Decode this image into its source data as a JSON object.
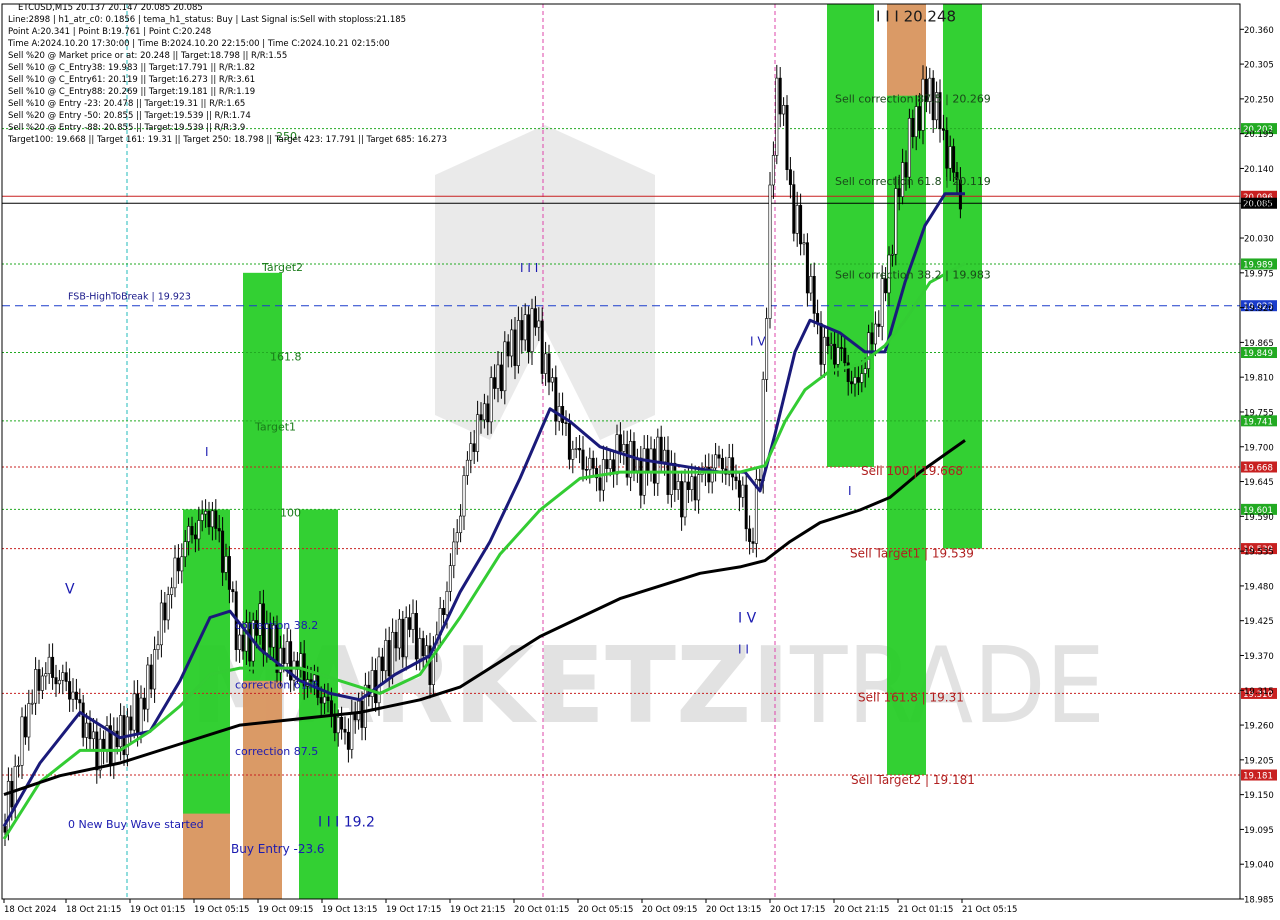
{
  "header": {
    "lines": [
      "ETCUSD,M15  20.137 20.147 20.085 20.085",
      "Line:2898 | h1_atr_c0: 0.1856 | tema_h1_status: Buy | Last Signal is:Sell with stoploss:21.185",
      "Point A:20.341 | Point B:19.761 | Point C:20.248",
      "Time A:2024.10.20 17:30:00 | Time B:2024.10.20 22:15:00 | Time C:2024.10.21 02:15:00",
      "Sell %20 @ Market price or at: 20.248 || Target:18.798 || R/R:1.55",
      "Sell %10 @ C_Entry38: 19.983 || Target:17.791 || R/R:1.82",
      "Sell %10 @ C_Entry61: 20.119 || Target:16.273 || R/R:3.61",
      "Sell %10 @ C_Entry88: 20.269 || Target:19.181 || R/R:1.19",
      "Sell %10 @ Entry -23: 20.478 || Target:19.31 || R/R:1.65",
      "Sell %20 @ Entry -50: 20.855 || Target:19.539 || R/R:1.74",
      "Sell %20 @ Entry -88: 20.855 || Target:19.539 || R/R:3.9",
      "Target100: 19.668 || Target 161: 19.31 || Target 250: 18.798 || Target 423: 17.791 || Target 685: 16.273"
    ]
  },
  "chart_data": {
    "type": "line",
    "symbol": "ETCUSD",
    "timeframe": "M15",
    "ylim": [
      18.985,
      20.4
    ],
    "y_ticks": [
      "20.360",
      "20.305",
      "20.250",
      "20.195",
      "20.140",
      "20.085",
      "20.030",
      "19.975",
      "19.920",
      "19.865",
      "19.810",
      "19.755",
      "19.700",
      "19.645",
      "19.590",
      "19.535",
      "19.480",
      "19.425",
      "19.370",
      "19.315",
      "19.260",
      "19.205",
      "19.150",
      "19.095",
      "19.040",
      "18.985"
    ],
    "x_ticks": [
      "18 Oct 2024",
      "18 Oct 21:15",
      "19 Oct 01:15",
      "19 Oct 05:15",
      "19 Oct 09:15",
      "19 Oct 13:15",
      "19 Oct 17:15",
      "19 Oct 21:15",
      "20 Oct 01:15",
      "20 Oct 05:15",
      "20 Oct 09:15",
      "20 Oct 13:15",
      "20 Oct 17:15",
      "20 Oct 21:15",
      "21 Oct 01:15",
      "21 Oct 05:15"
    ],
    "levels": [
      {
        "label": "20.203",
        "value": 20.203,
        "color": "#22aa22",
        "style": "dotted"
      },
      {
        "label": "20.096",
        "value": 20.096,
        "color": "#c82020",
        "style": "solid"
      },
      {
        "label": "20.085",
        "value": 20.085,
        "color": "#000000",
        "style": "solid"
      },
      {
        "label": "19.989",
        "value": 19.989,
        "color": "#22aa22",
        "style": "dotted"
      },
      {
        "label": "19.923",
        "value": 19.923,
        "color": "#1a3ccc",
        "style": "dashed"
      },
      {
        "label": "19.849",
        "value": 19.849,
        "color": "#22aa22",
        "style": "dotted"
      },
      {
        "label": "19.741",
        "value": 19.741,
        "color": "#22aa22",
        "style": "dotted"
      },
      {
        "label": "19.668",
        "value": 19.668,
        "color": "#c82020",
        "style": "dotted"
      },
      {
        "label": "19.601",
        "value": 19.601,
        "color": "#22aa22",
        "style": "dotted"
      },
      {
        "label": "19.539",
        "value": 19.539,
        "color": "#c82020",
        "style": "dotted"
      },
      {
        "label": "19.310",
        "value": 19.31,
        "color": "#c82020",
        "style": "dotted"
      },
      {
        "label": "19.181",
        "value": 19.181,
        "color": "#c82020",
        "style": "dotted"
      }
    ],
    "zones": [
      {
        "x0": 183,
        "x1": 230,
        "top": 19.601,
        "bottom": 18.985,
        "color": "#22cc22"
      },
      {
        "x0": 183,
        "x1": 230,
        "top": 19.12,
        "bottom": 18.985,
        "color": "#e8956a"
      },
      {
        "x0": 243,
        "x1": 282,
        "top": 19.975,
        "bottom": 18.985,
        "color": "#22cc22"
      },
      {
        "x0": 243,
        "x1": 282,
        "top": 19.33,
        "bottom": 18.985,
        "color": "#e8956a"
      },
      {
        "x0": 299,
        "x1": 338,
        "top": 19.601,
        "bottom": 18.985,
        "color": "#22cc22"
      },
      {
        "x0": 827,
        "x1": 874,
        "top": 20.4,
        "bottom": 19.668,
        "color": "#22cc22"
      },
      {
        "x0": 887,
        "x1": 926,
        "top": 20.4,
        "bottom": 19.181,
        "color": "#22cc22"
      },
      {
        "x0": 887,
        "x1": 926,
        "top": 20.4,
        "bottom": 20.255,
        "color": "#e8956a"
      },
      {
        "x0": 943,
        "x1": 982,
        "top": 20.4,
        "bottom": 19.539,
        "color": "#22cc22"
      }
    ],
    "annotations": [
      {
        "text": "FSB-HighToBreak | 19.923",
        "x": 68,
        "y": 19.933,
        "color": "#1a1a8a",
        "size": 9.5
      },
      {
        "text": "Target2",
        "x": 262,
        "y": 19.978,
        "color": "#1a7a1a",
        "size": 11
      },
      {
        "text": "161.8",
        "x": 270,
        "y": 19.836,
        "color": "#1a7a1a",
        "size": 11
      },
      {
        "text": "Target1",
        "x": 255,
        "y": 19.726,
        "color": "#1a7a1a",
        "size": 11
      },
      {
        "text": "100",
        "x": 280,
        "y": 19.59,
        "color": "#1a7a1a",
        "size": 11
      },
      {
        "text": "correction 38.2",
        "x": 235,
        "y": 19.412,
        "color": "#1a1ab0",
        "size": 11
      },
      {
        "text": "correction 61.8",
        "x": 235,
        "y": 19.318,
        "color": "#1a1ab0",
        "size": 11
      },
      {
        "text": "correction 87.5",
        "x": 235,
        "y": 19.213,
        "color": "#1a1ab0",
        "size": 11
      },
      {
        "text": "0 New Buy Wave started",
        "x": 68,
        "y": 19.097,
        "color": "#1a1ab0",
        "size": 11
      },
      {
        "text": "Buy Entry -23.6",
        "x": 231,
        "y": 19.058,
        "color": "#1a1ab0",
        "size": 12
      },
      {
        "text": "I I I 19.2",
        "x": 318,
        "y": 19.1,
        "color": "#1a1ab0",
        "size": 14
      },
      {
        "text": "V",
        "x": 65,
        "y": 19.468,
        "color": "#1a1ab0",
        "size": 14
      },
      {
        "text": "I",
        "x": 205,
        "y": 19.685,
        "color": "#1a1ab0",
        "size": 12
      },
      {
        "text": "I I I",
        "x": 520,
        "y": 19.976,
        "color": "#1a1ab0",
        "size": 12
      },
      {
        "text": "I V",
        "x": 750,
        "y": 19.86,
        "color": "#1a1ab0",
        "size": 12
      },
      {
        "text": "I V",
        "x": 738,
        "y": 19.422,
        "color": "#1a1ab0",
        "size": 14
      },
      {
        "text": "I I",
        "x": 738,
        "y": 19.373,
        "color": "#1a1ab0",
        "size": 12
      },
      {
        "text": "I",
        "x": 848,
        "y": 19.624,
        "color": "#1a1ab0",
        "size": 12
      },
      {
        "text": "I I I 20.248",
        "x": 876,
        "y": 20.372,
        "color": "#1a1a1a",
        "size": 15
      },
      {
        "text": "Sell correction 87.5 | 20.269",
        "x": 835,
        "y": 20.244,
        "color": "#1a4a1a",
        "size": 11
      },
      {
        "text": "Sell correction 61.8 | 20.119",
        "x": 835,
        "y": 20.114,
        "color": "#1a4a1a",
        "size": 11
      },
      {
        "text": "Sell correction 38.2 | 19.983",
        "x": 835,
        "y": 19.966,
        "color": "#1a4a1a",
        "size": 11
      },
      {
        "text": "Sell 100 | 19.668",
        "x": 861,
        "y": 19.655,
        "color": "#b02020",
        "size": 12
      },
      {
        "text": "Sell Target1 | 19.539",
        "x": 850,
        "y": 19.525,
        "color": "#b02020",
        "size": 12
      },
      {
        "text": "Sell 161.8 | 19.31",
        "x": 858,
        "y": 19.297,
        "color": "#b02020",
        "size": 12
      },
      {
        "text": "Sell Target2 | 19.181",
        "x": 851,
        "y": 19.167,
        "color": "#b02020",
        "size": 12
      },
      {
        "text": "250",
        "x": 276,
        "y": 20.185,
        "color": "#1a7a1a",
        "size": 11
      }
    ],
    "series": [
      {
        "type": "ma",
        "color": "#1a1a7a",
        "points": [
          [
            4,
            19.1
          ],
          [
            40,
            19.2
          ],
          [
            80,
            19.28
          ],
          [
            120,
            19.24
          ],
          [
            150,
            19.25
          ],
          [
            180,
            19.33
          ],
          [
            210,
            19.43
          ],
          [
            230,
            19.44
          ],
          [
            260,
            19.38
          ],
          [
            300,
            19.33
          ],
          [
            330,
            19.31
          ],
          [
            360,
            19.3
          ],
          [
            395,
            19.34
          ],
          [
            430,
            19.37
          ],
          [
            460,
            19.47
          ],
          [
            490,
            19.55
          ],
          [
            520,
            19.65
          ],
          [
            550,
            19.76
          ],
          [
            570,
            19.74
          ],
          [
            600,
            19.7
          ],
          [
            640,
            19.68
          ],
          [
            680,
            19.67
          ],
          [
            720,
            19.66
          ],
          [
            745,
            19.66
          ],
          [
            760,
            19.63
          ],
          [
            775,
            19.72
          ],
          [
            795,
            19.85
          ],
          [
            810,
            19.9
          ],
          [
            840,
            19.88
          ],
          [
            865,
            19.85
          ],
          [
            885,
            19.85
          ],
          [
            905,
            19.96
          ],
          [
            925,
            20.05
          ],
          [
            945,
            20.1
          ],
          [
            965,
            20.1
          ]
        ]
      },
      {
        "type": "ma",
        "color": "#33cc33",
        "points": [
          [
            4,
            19.08
          ],
          [
            40,
            19.17
          ],
          [
            80,
            19.22
          ],
          [
            120,
            19.22
          ],
          [
            150,
            19.25
          ],
          [
            180,
            19.29
          ],
          [
            210,
            19.34
          ],
          [
            240,
            19.35
          ],
          [
            270,
            19.35
          ],
          [
            300,
            19.35
          ],
          [
            340,
            19.33
          ],
          [
            380,
            19.31
          ],
          [
            420,
            19.34
          ],
          [
            460,
            19.43
          ],
          [
            500,
            19.53
          ],
          [
            540,
            19.6
          ],
          [
            580,
            19.65
          ],
          [
            620,
            19.66
          ],
          [
            660,
            19.66
          ],
          [
            700,
            19.66
          ],
          [
            740,
            19.66
          ],
          [
            765,
            19.67
          ],
          [
            785,
            19.74
          ],
          [
            805,
            19.79
          ],
          [
            830,
            19.82
          ],
          [
            860,
            19.83
          ],
          [
            885,
            19.86
          ],
          [
            905,
            19.9
          ],
          [
            930,
            19.96
          ],
          [
            965,
            19.99
          ]
        ]
      },
      {
        "type": "ma",
        "color": "#000000",
        "points": [
          [
            4,
            19.15
          ],
          [
            60,
            19.18
          ],
          [
            120,
            19.2
          ],
          [
            180,
            19.23
          ],
          [
            240,
            19.26
          ],
          [
            300,
            19.27
          ],
          [
            360,
            19.28
          ],
          [
            420,
            19.3
          ],
          [
            460,
            19.32
          ],
          [
            500,
            19.36
          ],
          [
            540,
            19.4
          ],
          [
            580,
            19.43
          ],
          [
            620,
            19.46
          ],
          [
            660,
            19.48
          ],
          [
            700,
            19.5
          ],
          [
            740,
            19.51
          ],
          [
            765,
            19.52
          ],
          [
            790,
            19.55
          ],
          [
            820,
            19.58
          ],
          [
            860,
            19.6
          ],
          [
            890,
            19.62
          ],
          [
            920,
            19.66
          ],
          [
            965,
            19.71
          ]
        ]
      }
    ]
  },
  "watermark": {
    "word1": "MARKETZI",
    "word2": "TRADE"
  }
}
